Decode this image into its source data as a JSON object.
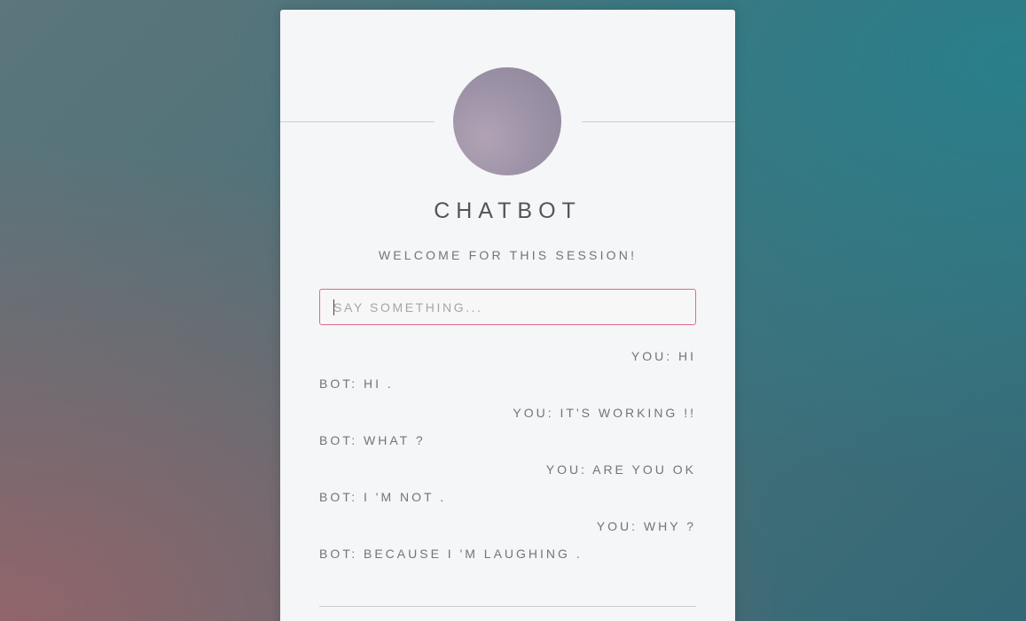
{
  "app": {
    "title": "CHATBOT",
    "subtitle": "WELCOME FOR THIS SESSION!"
  },
  "input": {
    "placeholder": "SAY SOMETHING...",
    "value": ""
  },
  "messages": [
    {
      "sender": "you",
      "text": "YOU: HI"
    },
    {
      "sender": "bot",
      "text": "BOT: HI ."
    },
    {
      "sender": "you",
      "text": "YOU: IT'S WORKING !!"
    },
    {
      "sender": "bot",
      "text": "BOT: WHAT ?"
    },
    {
      "sender": "you",
      "text": "YOU: ARE YOU OK"
    },
    {
      "sender": "bot",
      "text": "BOT: I 'M NOT ."
    },
    {
      "sender": "you",
      "text": "YOU: WHY ?"
    },
    {
      "sender": "bot",
      "text": "BOT: BECAUSE I 'M LAUGHING ."
    }
  ],
  "colors": {
    "accent_border": "#e06a8c",
    "text": "#6f767c",
    "card": "#f5f6f7"
  },
  "icons": {
    "avatar": "bot-avatar-circle"
  }
}
